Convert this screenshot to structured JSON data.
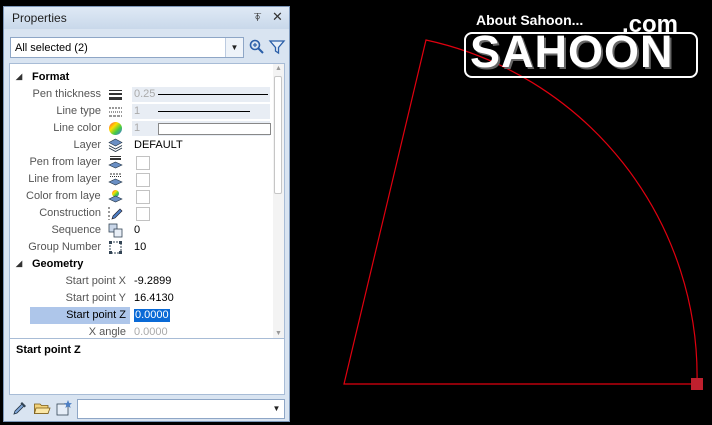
{
  "panel": {
    "title": "Properties",
    "pin_glyph": "⍕",
    "close_glyph": "✕",
    "selection": "All selected (2)",
    "description_title": "Start point Z"
  },
  "format": {
    "label": "Format",
    "rows": [
      {
        "name": "Pen thickness",
        "icon": "pen-thickness-icon",
        "value": "0.25"
      },
      {
        "name": "Line type",
        "icon": "line-type-icon",
        "value": "1"
      },
      {
        "name": "Line color",
        "icon": "color-wheel-icon",
        "value": "1"
      },
      {
        "name": "Layer",
        "icon": "layers-icon",
        "value": "DEFAULT"
      },
      {
        "name": "Pen from layer",
        "icon": "pen-from-layer-icon"
      },
      {
        "name": "Line from layer",
        "icon": "line-from-layer-icon"
      },
      {
        "name": "Color from layer",
        "icon": "color-from-layer-icon"
      },
      {
        "name": "Construction",
        "icon": "construction-pencil-icon"
      },
      {
        "name": "Sequence",
        "icon": "sequence-icon",
        "value": "0"
      },
      {
        "name": "Group Number",
        "icon": "group-number-icon",
        "value": "10"
      }
    ]
  },
  "geometry": {
    "label": "Geometry",
    "rows": [
      {
        "name": "Start point X",
        "value": "-9.2899"
      },
      {
        "name": "Start point Y",
        "value": "16.4130"
      },
      {
        "name": "Start point Z",
        "value": "0.0000"
      },
      {
        "name": "X angle",
        "value": "0.0000"
      }
    ]
  },
  "logo": {
    "about": "About Sahoon...",
    "com": ".com",
    "name": "SAHOON"
  },
  "colors": {
    "drawing_line": "#e0000f",
    "grip": "#c0202e",
    "panel_bg": "#d9e4f1",
    "selection": "#0a6ad6"
  }
}
